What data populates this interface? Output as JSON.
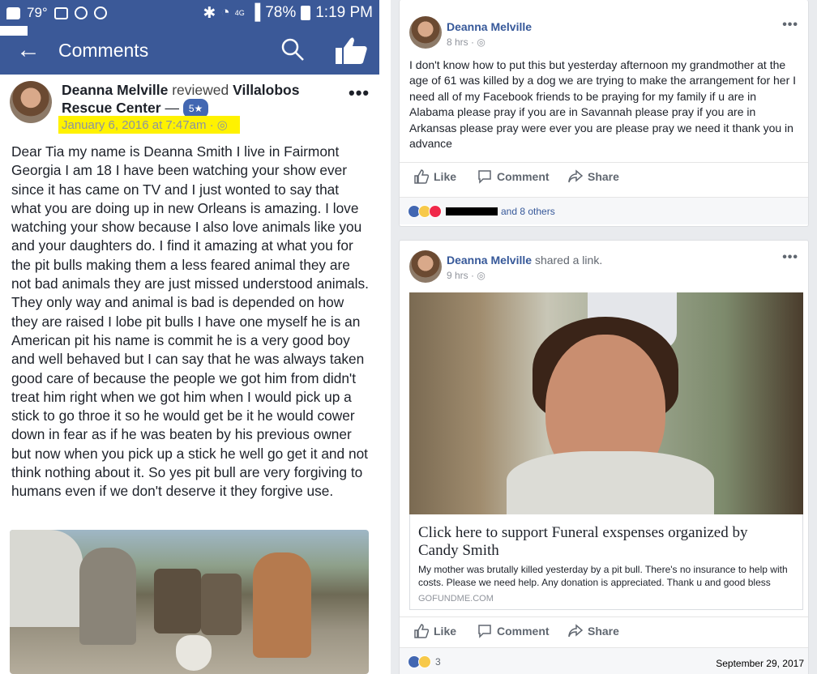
{
  "left": {
    "statusbar": {
      "temperature": "79°",
      "network": "4G",
      "battery": "78%",
      "time": "1:19 PM"
    },
    "navbar": {
      "back_icon": "back-arrow-icon",
      "title": "Comments",
      "search_icon": "search-icon",
      "like_icon": "thumbs-up-icon"
    },
    "review": {
      "author": "Deanna Melville",
      "verb": "reviewed",
      "page_line1": "Villalobos",
      "page_line2": "Rescue Center",
      "dash": "—",
      "rating": "5★",
      "date": "January 6, 2016 at 7:47am ·",
      "body": "Dear Tia my name is Deanna Smith I live in Fairmont Georgia I am 18 I have been watching your show ever since it has came on TV and I just wonted to say that what you are doing up in new Orleans is amazing. I love watching your show because I also love animals like you and your daughters do. I find it amazing at what you for the pit bulls making them a less feared animal they are not bad animals they are just missed understood animals. They only way and animal is bad is depended on how they are raised I lobe pit bulls I have one myself he is an American pit his name is commit he is a very good boy and well behaved but I can say that he was always taken good care of because the people we got him from didn't treat him right when we got him when I would pick up a stick to go throe it so he would get be it he would cower down in fear as if he was beaten by his previous owner but now when you pick up a stick he well go get it and not think nothing about it. So yes pit bull are very forgiving to humans even if we don't deserve it they forgive use."
    }
  },
  "right": {
    "post1": {
      "author": "Deanna Melville",
      "time": "8 hrs ·",
      "text": "I don't know how to put this but yesterday afternoon my grandmother at the age of 61 was killed by a dog we are trying to make the arrangement for her I need all of my Facebook friends to be praying for my family if u are in Alabama please pray if you are in Savannah please pray if you are in Arkansas please pray were ever you are please pray we need it thank you in advance",
      "actions": {
        "like": "Like",
        "comment": "Comment",
        "share": "Share"
      },
      "reactions_others": "and 8 others"
    },
    "post2": {
      "author": "Deanna Melville",
      "shared": "shared a link.",
      "time": "9 hrs ·",
      "link_title": "Click here to support Funeral exspenses organized by Candy Smith",
      "link_desc": "My mother was brutally killed yesterday by a pit bull. There's no insurance to help with costs. Please we need help. Any donation is appreciated. Thank u and good bless",
      "link_source": "GOFUNDME.COM",
      "actions": {
        "like": "Like",
        "comment": "Comment",
        "share": "Share"
      },
      "reactions_count": "3"
    },
    "date_stamp": "September 29, 2017"
  },
  "colors": {
    "facebook_blue": "#3b5998",
    "link_blue": "#365899",
    "highlight": "#fff200"
  }
}
